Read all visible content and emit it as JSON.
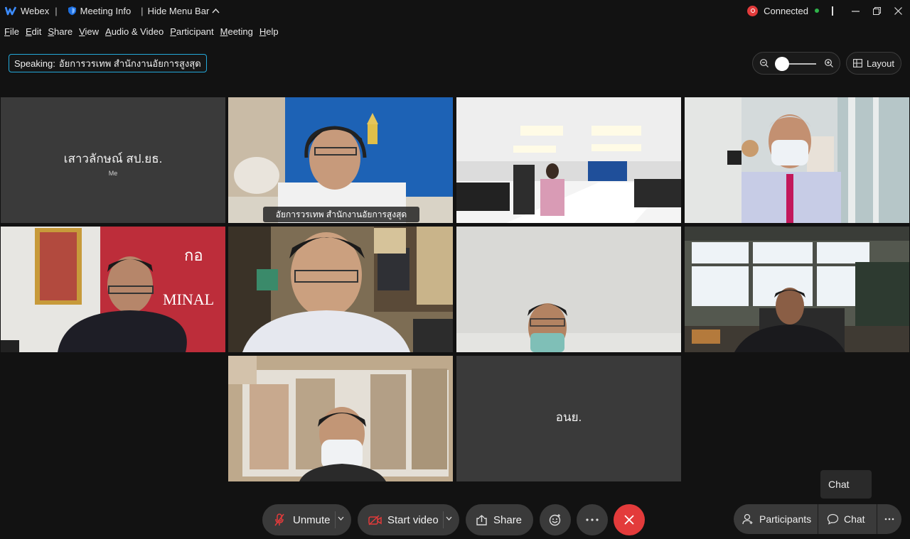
{
  "titlebar": {
    "app_name": "Webex",
    "meeting_info": "Meeting Info",
    "hide_menu_bar": "Hide Menu Bar",
    "connection_status": "Connected",
    "colors": {
      "connected_green": "#2fb34a",
      "alert_red": "#e23b3b",
      "accent_blue": "#27a9e1"
    }
  },
  "menu": [
    "File",
    "Edit",
    "Share",
    "View",
    "Audio & Video",
    "Participant",
    "Meeting",
    "Help"
  ],
  "speaking": {
    "label": "Speaking:",
    "name": "อัยการวรเทพ สำนักงานอัยการสูงสุด"
  },
  "layout_button": "Layout",
  "zoom_icons": [
    "zoom-out-icon",
    "zoom-in-icon"
  ],
  "tiles": [
    {
      "name": "เสาวลักษณ์ สป.ยธ.",
      "sub": "Me"
    },
    {
      "name": "อัยการวรเทพ สำนักงานอัยการสูงสุด"
    },
    {
      "name": "อนย."
    }
  ],
  "controls": {
    "unmute": "Unmute",
    "start_video": "Start video",
    "share": "Share",
    "participants": "Participants",
    "chat": "Chat",
    "chat_tooltip": "Chat"
  }
}
